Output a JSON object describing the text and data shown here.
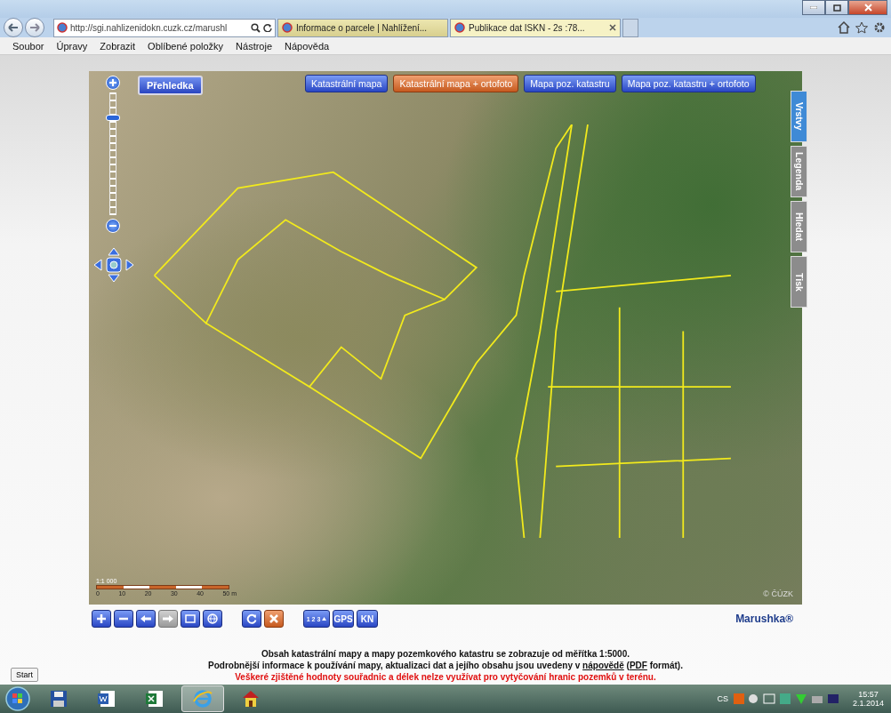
{
  "browser": {
    "address": "http://sgi.nahlizenidokn.cuzk.cz/marushl",
    "tabs": [
      {
        "label": "Informace o parcele | Nahlížení...",
        "selected": false
      },
      {
        "label": "Publikace dat ISKN - 2s :78...",
        "selected": true
      }
    ],
    "menu": [
      "Soubor",
      "Úpravy",
      "Zobrazit",
      "Oblíbené položky",
      "Nástroje",
      "Nápověda"
    ]
  },
  "map": {
    "overview_button": "Přehledka",
    "layer_buttons": [
      {
        "label": "Katastrální mapa",
        "selected": false
      },
      {
        "label": "Katastrální mapa + ortofoto",
        "selected": true
      },
      {
        "label": "Mapa poz. katastru",
        "selected": false
      },
      {
        "label": "Mapa poz. katastru + ortofoto",
        "selected": false
      }
    ],
    "side_tabs": [
      {
        "label": "Vrstvy",
        "selected": true
      },
      {
        "label": "Legenda",
        "selected": false
      },
      {
        "label": "Hledat",
        "selected": false
      },
      {
        "label": "Tisk",
        "selected": false
      }
    ],
    "zoom_slider": {
      "level": 0.8
    },
    "scale": {
      "ratio": "1:1 000",
      "ticks": [
        "0",
        "10",
        "20",
        "30",
        "40",
        "50 m"
      ]
    },
    "copyright": "© ČÚZK"
  },
  "toolbar": {
    "buttons": [
      {
        "kind": "plus",
        "disabled": false
      },
      {
        "kind": "minus",
        "disabled": false
      },
      {
        "kind": "back",
        "disabled": false
      },
      {
        "kind": "forward",
        "disabled": true
      },
      {
        "kind": "rect",
        "disabled": false
      },
      {
        "kind": "globe",
        "disabled": false
      },
      {
        "kind": "gap"
      },
      {
        "kind": "refresh",
        "disabled": false
      },
      {
        "kind": "cancel",
        "disabled": false
      },
      {
        "kind": "gap"
      },
      {
        "kind": "numbers",
        "label": "1 2 3",
        "disabled": false
      },
      {
        "kind": "text",
        "label": "GPS",
        "disabled": false
      },
      {
        "kind": "text",
        "label": "KN",
        "disabled": false
      }
    ],
    "brand": "Marushka®"
  },
  "notes": [
    {
      "kind": "normal",
      "parts": [
        {
          "text": "Obsah katastrální mapy a mapy pozemkového katastru se zobrazuje od měřítka 1:5000."
        }
      ]
    },
    {
      "kind": "normal",
      "parts": [
        {
          "text": "Podrobnější informace k používání mapy, aktualizaci dat a jejího obsahu jsou uvedeny v "
        },
        {
          "text": "nápovědě",
          "link": true
        },
        {
          "text": " ("
        },
        {
          "text": "PDF",
          "link": true
        },
        {
          "text": " formát)."
        }
      ]
    },
    {
      "kind": "warning",
      "parts": [
        {
          "text": "Veškeré zjištěné hodnoty souřadnic a délek nelze využívat pro vytyčování hranic pozemků v terénu."
        }
      ]
    }
  ],
  "start_button": "Start",
  "taskbar": {
    "apps": [
      {
        "kind": "save",
        "active": false
      },
      {
        "kind": "word",
        "active": false
      },
      {
        "kind": "excel",
        "active": false
      },
      {
        "kind": "browser",
        "active": true
      },
      {
        "kind": "house",
        "active": false
      }
    ],
    "language": "CS",
    "time": "15:57",
    "date": "2.1.2014"
  }
}
